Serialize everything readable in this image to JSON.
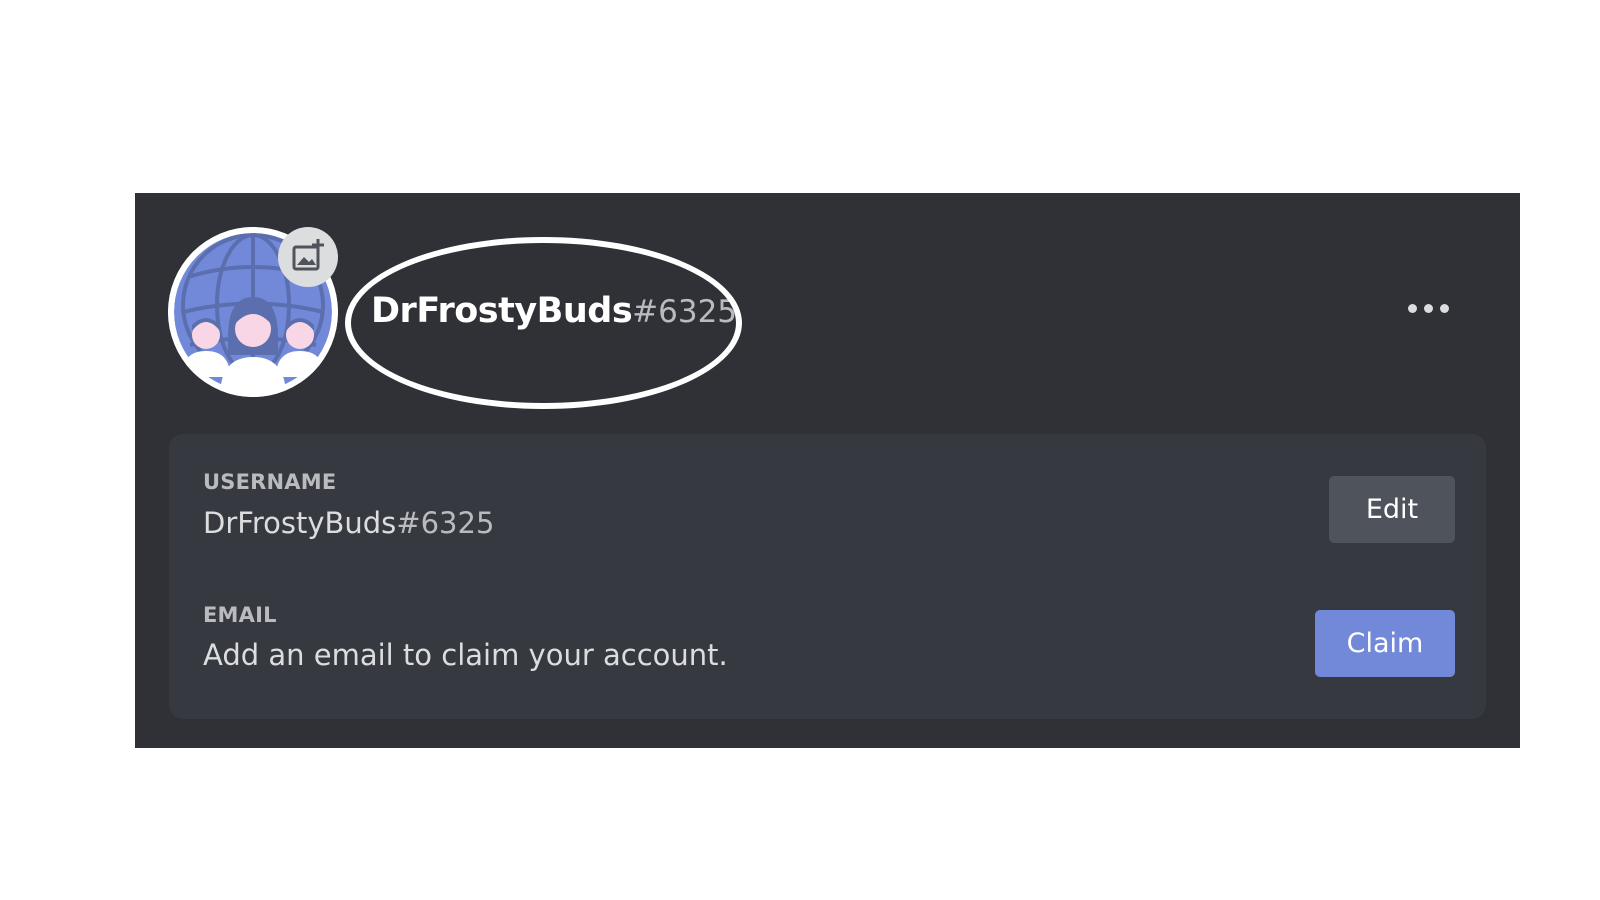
{
  "profile": {
    "username": "DrFrostyBuds",
    "discriminator": "#6325",
    "avatar_icon": "people-globe-avatar",
    "upload_icon": "add-image-icon",
    "more_icon": "more-options-icon"
  },
  "account_info": {
    "username_label": "USERNAME",
    "username_value": "DrFrostyBuds",
    "username_tag": "#6325",
    "edit_label": "Edit",
    "email_label": "EMAIL",
    "email_value": "Add an email to claim your account.",
    "claim_label": "Claim"
  },
  "colors": {
    "card_bg": "#2f3136",
    "panel_bg": "#36393f",
    "avatar_blurple": "#7289da",
    "edit_button": "#4f545c",
    "claim_button": "#7289da",
    "highlight": "#ffffff"
  }
}
